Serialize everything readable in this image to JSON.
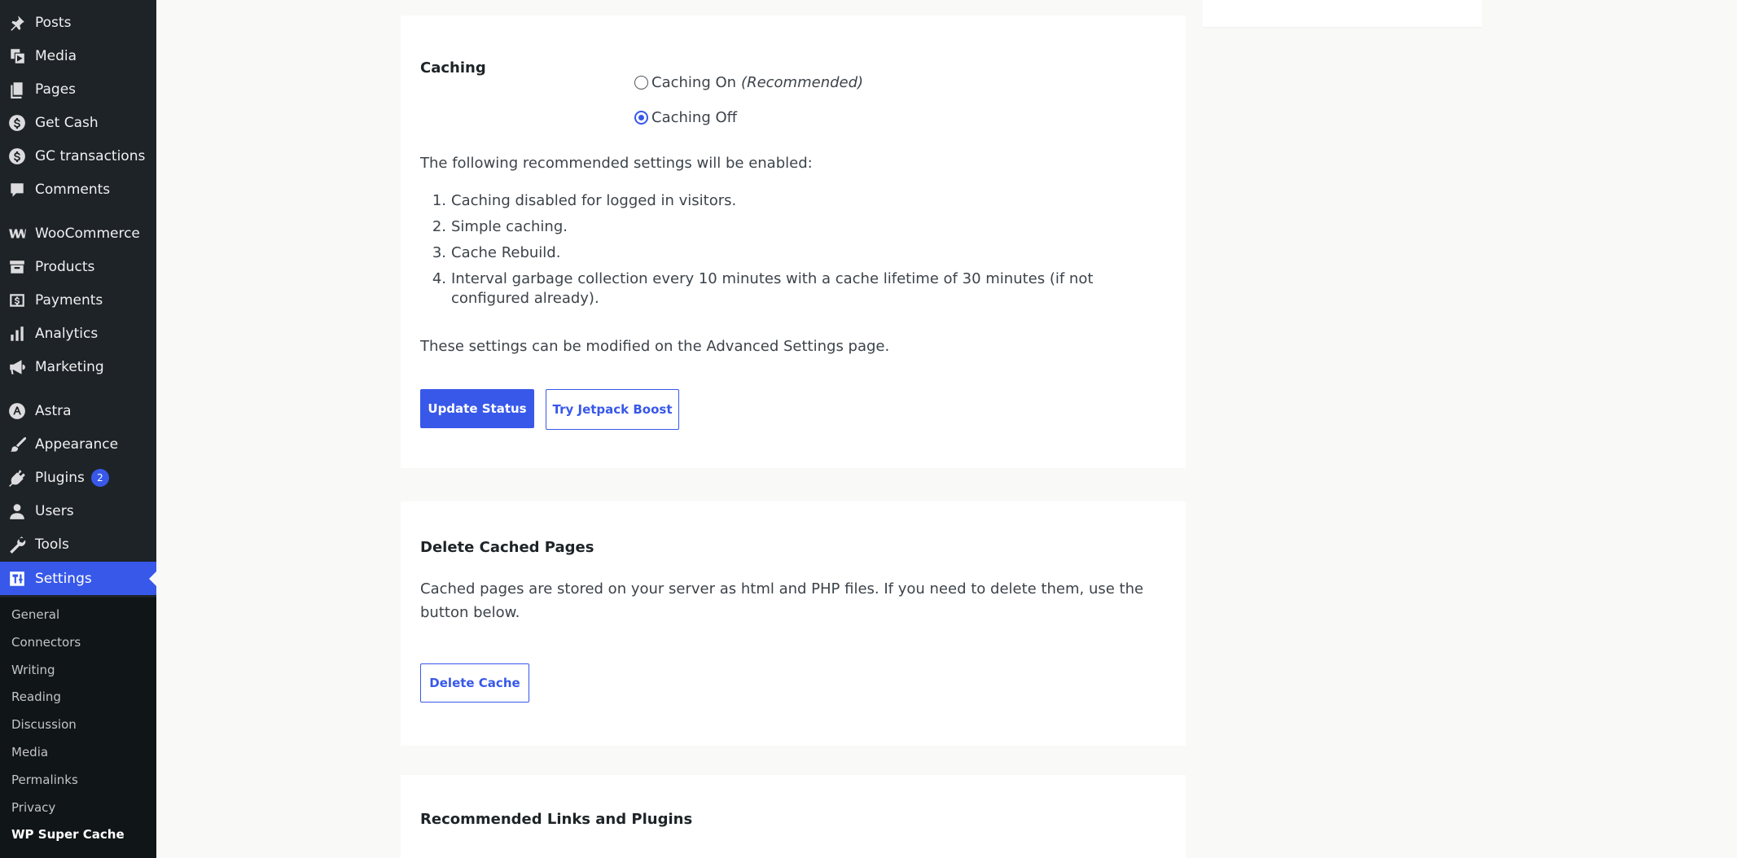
{
  "sidebar": {
    "items": [
      {
        "label": "Posts",
        "icon": "pin-icon"
      },
      {
        "label": "Media",
        "icon": "media-icon"
      },
      {
        "label": "Pages",
        "icon": "pages-icon"
      },
      {
        "label": "Get Cash",
        "icon": "dollar-icon"
      },
      {
        "label": "GC transactions",
        "icon": "dollar-icon"
      },
      {
        "label": "Comments",
        "icon": "comment-icon"
      },
      {
        "label": "WooCommerce",
        "icon": "woo-icon"
      },
      {
        "label": "Products",
        "icon": "archive-icon"
      },
      {
        "label": "Payments",
        "icon": "payment-icon"
      },
      {
        "label": "Analytics",
        "icon": "bar-chart-icon"
      },
      {
        "label": "Marketing",
        "icon": "megaphone-icon"
      },
      {
        "label": "Astra",
        "icon": "astra-icon"
      },
      {
        "label": "Appearance",
        "icon": "brush-icon"
      },
      {
        "label": "Plugins",
        "icon": "plugin-icon",
        "badge": "2"
      },
      {
        "label": "Users",
        "icon": "user-icon"
      },
      {
        "label": "Tools",
        "icon": "wrench-icon"
      },
      {
        "label": "Settings",
        "icon": "settings-icon",
        "active": true
      }
    ],
    "submenu": [
      "General",
      "Connectors",
      "Writing",
      "Reading",
      "Discussion",
      "Media",
      "Permalinks",
      "Privacy",
      "WP Super Cache"
    ]
  },
  "caching": {
    "label": "Caching",
    "option_on": "Caching On",
    "option_on_note": "(Recommended)",
    "option_off": "Caching Off",
    "selected": "off",
    "intro": "The following recommended settings will be enabled:",
    "list": [
      {
        "num": "1.",
        "text": "Caching disabled for logged in visitors."
      },
      {
        "num": "2.",
        "text": "Simple caching."
      },
      {
        "num": "3.",
        "text": "Cache Rebuild."
      },
      {
        "num": "4.",
        "text": "Interval garbage collection every 10 minutes with a cache lifetime of 30 minutes (if not configured already)."
      }
    ],
    "footer": "These settings can be modified on the Advanced Settings page.",
    "update_button": "Update Status",
    "jetpack_button": "Try Jetpack Boost"
  },
  "delete_cache": {
    "title": "Delete Cached Pages",
    "description": "Cached pages are stored on your server as html and PHP files. If you need to delete them, use the button below.",
    "button": "Delete Cache"
  },
  "recommended": {
    "title": "Recommended Links and Plugins"
  },
  "colors": {
    "sidebar_bg": "#1d2327",
    "accent": "#3858e9",
    "page_bg": "#f9f9f8"
  }
}
